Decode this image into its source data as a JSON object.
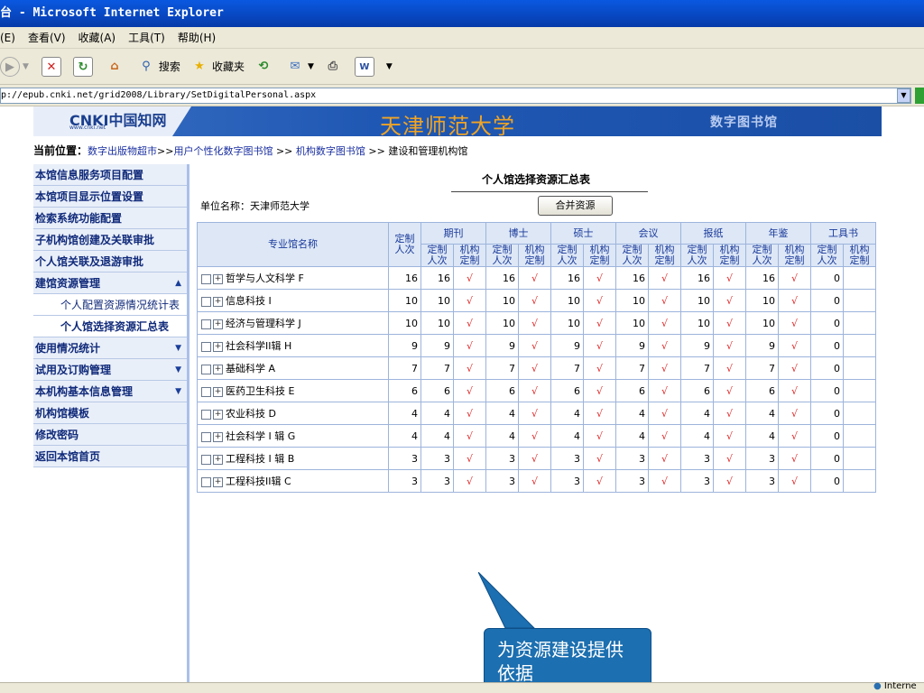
{
  "window": {
    "title": "台 - Microsoft Internet Explorer"
  },
  "menu": [
    "(E)",
    "查看(V)",
    "收藏(A)",
    "工具(T)",
    "帮助(H)"
  ],
  "toolbar": {
    "search": "搜索",
    "favorites": "收藏夹"
  },
  "address": {
    "url": "p://epub.cnki.net/grid2008/Library/SetDigitalPersonal.aspx"
  },
  "banner": {
    "title": "天津师范大学",
    "right": "数字图书馆",
    "logo_text": "CNKI中国知网",
    "logo_sub": "www.cnki.net"
  },
  "breadcrumb": {
    "label": "当前位置：",
    "link1": "数字出版物超市",
    "sep1": ">>",
    "link2": "用户个性化数字图书馆",
    "sep2": " >> ",
    "link3": "机构数字图书馆",
    "sep3": " >> ",
    "current": "建设和管理机构馆"
  },
  "sidebar": {
    "items": [
      {
        "label": "本馆信息服务项目配置"
      },
      {
        "label": "本馆项目显示位置设置"
      },
      {
        "label": "检索系统功能配置"
      },
      {
        "label": "子机构馆创建及关联审批"
      },
      {
        "label": "个人馆关联及退游审批"
      },
      {
        "label": "建馆资源管理",
        "arrow": "▲"
      },
      {
        "label": "个人配置资源情况统计表"
      },
      {
        "label": "个人馆选择资源汇总表"
      },
      {
        "label": "使用情况统计",
        "arrow": "▼"
      },
      {
        "label": "试用及订购管理",
        "arrow": "▼"
      },
      {
        "label": "本机构基本信息管理",
        "arrow": "▼"
      },
      {
        "label": "机构馆模板"
      },
      {
        "label": "修改密码"
      },
      {
        "label": "返回本馆首页"
      }
    ]
  },
  "main": {
    "heading": "个人馆选择资源汇总表",
    "unit": "单位名称：天津师范大学",
    "merge_button": "合并资源",
    "columns": {
      "name": "专业馆名称",
      "total": "定制人次",
      "groups": [
        "期刊",
        "博士",
        "硕士",
        "会议",
        "报纸",
        "年鉴",
        "工具书"
      ],
      "sub1": "定制人次",
      "sub2": "机构定制"
    },
    "rows": [
      {
        "name": "哲学与人文科学 F",
        "total": "16",
        "vals": [
          "16",
          "16",
          "16",
          "16",
          "16",
          "16",
          "0"
        ]
      },
      {
        "name": "信息科技 I",
        "total": "10",
        "vals": [
          "10",
          "10",
          "10",
          "10",
          "10",
          "10",
          "0"
        ]
      },
      {
        "name": "经济与管理科学 J",
        "total": "10",
        "vals": [
          "10",
          "10",
          "10",
          "10",
          "10",
          "10",
          "0"
        ]
      },
      {
        "name": "社会科学II辑 H",
        "total": "9",
        "vals": [
          "9",
          "9",
          "9",
          "9",
          "9",
          "9",
          "0"
        ]
      },
      {
        "name": "基础科学 A",
        "total": "7",
        "vals": [
          "7",
          "7",
          "7",
          "7",
          "7",
          "7",
          "0"
        ]
      },
      {
        "name": "医药卫生科技 E",
        "total": "6",
        "vals": [
          "6",
          "6",
          "6",
          "6",
          "6",
          "6",
          "0"
        ]
      },
      {
        "name": "农业科技 D",
        "total": "4",
        "vals": [
          "4",
          "4",
          "4",
          "4",
          "4",
          "4",
          "0"
        ]
      },
      {
        "name": "社会科学 I 辑 G",
        "total": "4",
        "vals": [
          "4",
          "4",
          "4",
          "4",
          "4",
          "4",
          "0"
        ]
      },
      {
        "name": "工程科技 I 辑 B",
        "total": "3",
        "vals": [
          "3",
          "3",
          "3",
          "3",
          "3",
          "3",
          "0"
        ]
      },
      {
        "name": "工程科技II辑 C",
        "total": "3",
        "vals": [
          "3",
          "3",
          "3",
          "3",
          "3",
          "3",
          "0"
        ]
      }
    ],
    "check_mark": "√",
    "check_color": "#e02020"
  },
  "callout": {
    "text": "为资源建设提供依据"
  },
  "status": {
    "zone": "Interne"
  }
}
